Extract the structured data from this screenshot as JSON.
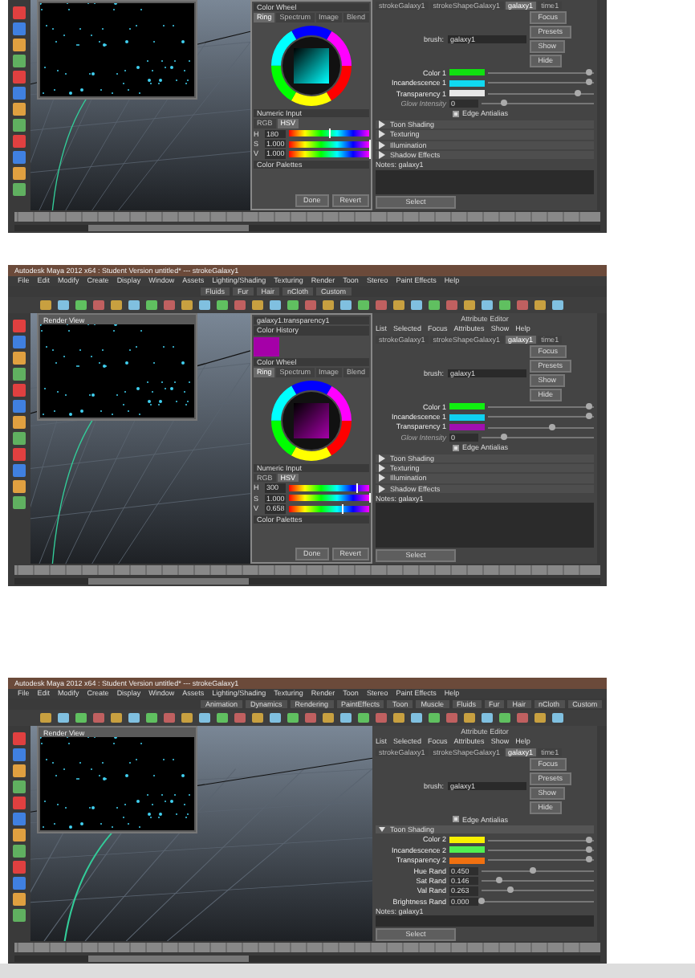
{
  "screenshots": [
    {
      "color_chooser": {
        "sections": [
          "Color Wheel",
          "Numeric Input",
          "Color Palettes"
        ],
        "wheel_tabs": [
          {
            "label": "Ring",
            "selected": true
          },
          {
            "label": "Spectrum",
            "selected": false
          },
          {
            "label": "Image",
            "selected": false
          },
          {
            "label": "Blend",
            "selected": false
          }
        ],
        "mode_tabs": [
          {
            "label": "RGB",
            "selected": false
          },
          {
            "label": "HSV",
            "selected": true
          }
        ],
        "channels": [
          {
            "name": "H",
            "value": "180",
            "level": 0.5
          },
          {
            "name": "S",
            "value": "1.000",
            "level": 1
          },
          {
            "name": "V",
            "value": "1.000",
            "level": 1
          }
        ],
        "buttons": [
          "Done",
          "Revert"
        ]
      },
      "attribute_editor": {
        "tabs": [
          {
            "label": "strokeGalaxy1",
            "selected": false
          },
          {
            "label": "strokeShapeGalaxy1",
            "selected": false
          },
          {
            "label": "galaxy1",
            "selected": true
          },
          {
            "label": "time1",
            "selected": false
          }
        ],
        "field_label": "brush:",
        "field_value": "galaxy1",
        "buttons": [
          "Focus",
          "Presets",
          "Show",
          "Hide"
        ],
        "rows": [
          {
            "kind": "color",
            "label": "Color 1",
            "color": "#10e010",
            "level": 0.95
          },
          {
            "kind": "color",
            "label": "Incandescence 1",
            "color": "#10d8f0",
            "level": 0.95
          },
          {
            "kind": "color",
            "label": "Transparency 1",
            "color": "#e8e8e8",
            "level": 0.85
          },
          {
            "kind": "number",
            "label": "Glow Intensity",
            "value": "0",
            "level": 0.2,
            "disabled": true
          },
          {
            "kind": "check",
            "label": "Edge Antialias",
            "checked": true
          },
          {
            "kind": "section",
            "label": "Toon Shading",
            "expanded": false
          },
          {
            "kind": "section",
            "label": "Texturing",
            "expanded": false
          },
          {
            "kind": "section",
            "label": "Illumination",
            "expanded": false
          },
          {
            "kind": "section",
            "label": "Shadow Effects",
            "expanded": false
          }
        ],
        "notes": "Notes: galaxy1",
        "select": "Select"
      }
    },
    {
      "title": "Autodesk Maya 2012 x64 : Student Version untitled*  ---  strokeGalaxy1",
      "menu": [
        "File",
        "Edit",
        "Modify",
        "Create",
        "Display",
        "Window",
        "Assets",
        "Lighting/Shading",
        "Texturing",
        "Render",
        "Toon",
        "Stereo",
        "Paint Effects",
        "Help"
      ],
      "shelf_tabs": [
        "Fluids",
        "Fur",
        "Hair",
        "nCloth",
        "Custom"
      ],
      "render_view": {
        "title": "Render View"
      },
      "color_chooser": {
        "title": "galaxy1.transparency1",
        "history": "Color History",
        "sections": [
          "Color Wheel",
          "Numeric Input",
          "Color Palettes"
        ],
        "wheel_tabs": [
          {
            "label": "Ring",
            "selected": true
          },
          {
            "label": "Spectrum",
            "selected": false
          },
          {
            "label": "Image",
            "selected": false
          },
          {
            "label": "Blend",
            "selected": false
          }
        ],
        "mode_tabs": [
          {
            "label": "RGB",
            "selected": false
          },
          {
            "label": "HSV",
            "selected": true
          }
        ],
        "channels": [
          {
            "name": "H",
            "value": "300",
            "level": 0.83
          },
          {
            "name": "S",
            "value": "1.000",
            "level": 1
          },
          {
            "name": "V",
            "value": "0.658",
            "level": 0.66
          }
        ],
        "buttons": [
          "Done",
          "Revert"
        ]
      },
      "attribute_editor": {
        "title": "Attribute Editor",
        "menu": [
          "List",
          "Selected",
          "Focus",
          "Attributes",
          "Show",
          "Help"
        ],
        "tabs": [
          {
            "label": "strokeGalaxy1",
            "selected": false
          },
          {
            "label": "strokeShapeGalaxy1",
            "selected": false
          },
          {
            "label": "galaxy1",
            "selected": true
          },
          {
            "label": "time1",
            "selected": false
          }
        ],
        "field_label": "brush:",
        "field_value": "galaxy1",
        "buttons": [
          "Focus",
          "Presets",
          "Show",
          "Hide"
        ],
        "rows": [
          {
            "kind": "color",
            "label": "Color 1",
            "color": "#10f010",
            "level": 0.95
          },
          {
            "kind": "color",
            "label": "Incandescence 1",
            "color": "#10d0f0",
            "level": 0.95
          },
          {
            "kind": "color",
            "label": "Transparency 1",
            "color": "#a010b0",
            "level": 0.6
          },
          {
            "kind": "number",
            "label": "Glow Intensity",
            "value": "0",
            "level": 0.2,
            "disabled": true
          },
          {
            "kind": "check",
            "label": "Edge Antialias",
            "checked": true
          },
          {
            "kind": "section",
            "label": "Toon Shading",
            "expanded": false
          },
          {
            "kind": "section",
            "label": "Texturing",
            "expanded": false
          },
          {
            "kind": "section",
            "label": "Illumination",
            "expanded": false
          },
          {
            "kind": "section",
            "label": "Shadow Effects",
            "expanded": false
          }
        ],
        "notes": "Notes: galaxy1",
        "select": "Select"
      }
    },
    {
      "title": "Autodesk Maya 2012 x64 : Student Version untitled*  ---  strokeGalaxy1",
      "menu": [
        "File",
        "Edit",
        "Modify",
        "Create",
        "Display",
        "Window",
        "Assets",
        "Lighting/Shading",
        "Texturing",
        "Render",
        "Toon",
        "Stereo",
        "Paint Effects",
        "Help"
      ],
      "shelf_tabs": [
        "Animation",
        "Dynamics",
        "Rendering",
        "PaintEffects",
        "Toon",
        "Muscle",
        "Fluids",
        "Fur",
        "Hair",
        "nCloth",
        "Custom"
      ],
      "render_view": {
        "title": "Render View"
      },
      "attribute_editor": {
        "title": "Attribute Editor",
        "menu": [
          "List",
          "Selected",
          "Focus",
          "Attributes",
          "Show",
          "Help"
        ],
        "tabs": [
          {
            "label": "strokeGalaxy1",
            "selected": false
          },
          {
            "label": "strokeShapeGalaxy1",
            "selected": false
          },
          {
            "label": "galaxy1",
            "selected": true
          },
          {
            "label": "time1",
            "selected": false
          }
        ],
        "field_label": "brush:",
        "field_value": "galaxy1",
        "buttons": [
          "Focus",
          "Presets",
          "Show",
          "Hide"
        ],
        "rows": [
          {
            "kind": "check",
            "label": "Edge Antialias",
            "checked": true
          },
          {
            "kind": "section",
            "label": "Toon Shading",
            "expanded": true
          },
          {
            "kind": "color",
            "label": "Color 2",
            "color": "#f8f000",
            "level": 0.95
          },
          {
            "kind": "color",
            "label": "Incandescence 2",
            "color": "#50f050",
            "level": 0.95
          },
          {
            "kind": "color",
            "label": "Transparency 2",
            "color": "#f07010",
            "level": 0.95
          },
          {
            "kind": "number",
            "label": "Hue Rand",
            "value": "0.450",
            "level": 0.45,
            "disabled": false
          },
          {
            "kind": "number",
            "label": "Sat Rand",
            "value": "0.146",
            "level": 0.15,
            "disabled": false
          },
          {
            "kind": "number",
            "label": "Val Rand",
            "value": "0.263",
            "level": 0.26,
            "disabled": false
          },
          {
            "kind": "number",
            "label": "Brightness Rand",
            "value": "0.000",
            "level": 0,
            "disabled": false
          }
        ],
        "notes": "Notes: galaxy1",
        "select": "Select"
      }
    }
  ]
}
